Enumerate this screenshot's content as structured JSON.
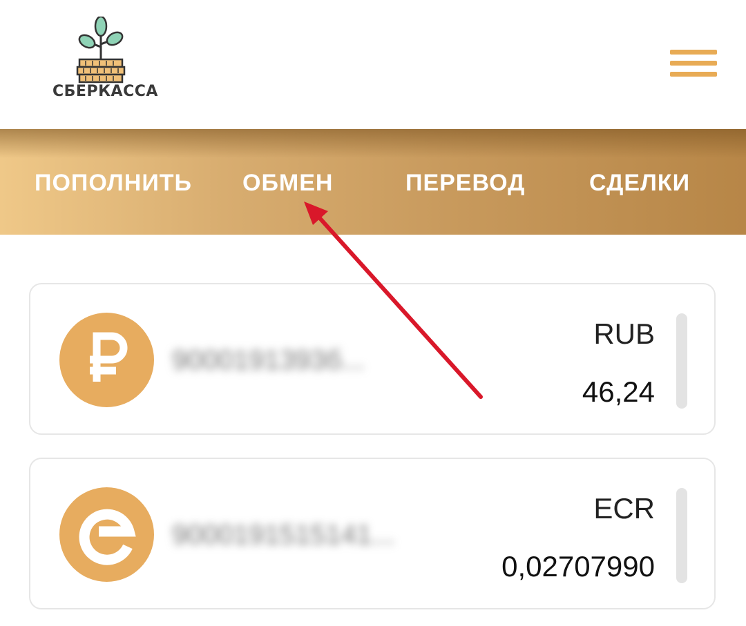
{
  "header": {
    "logo_text": "СБЕРКАССА",
    "logo_icon": "sprout-on-coins-logo",
    "menu_icon": "hamburger-menu-icon"
  },
  "nav": {
    "items": [
      {
        "label": "ПОПОЛНИТЬ"
      },
      {
        "label": "ОБМЕН"
      },
      {
        "label": "ПЕРЕВОД"
      },
      {
        "label": "СДЕЛКИ"
      }
    ]
  },
  "accounts": [
    {
      "icon": "ruble-icon",
      "number": "9000191393б...",
      "currency": "RUB",
      "balance": "46,24"
    },
    {
      "icon": "ecoin-icon",
      "number": "9000191515141...",
      "currency": "ECR",
      "balance": "0,02707990"
    }
  ],
  "colors": {
    "accent": "#e8ab55",
    "coin": "#e7ac5f",
    "nav_gradient_start": "#efc888",
    "nav_gradient_end": "#b78647",
    "annotation_arrow": "#d9182a"
  }
}
